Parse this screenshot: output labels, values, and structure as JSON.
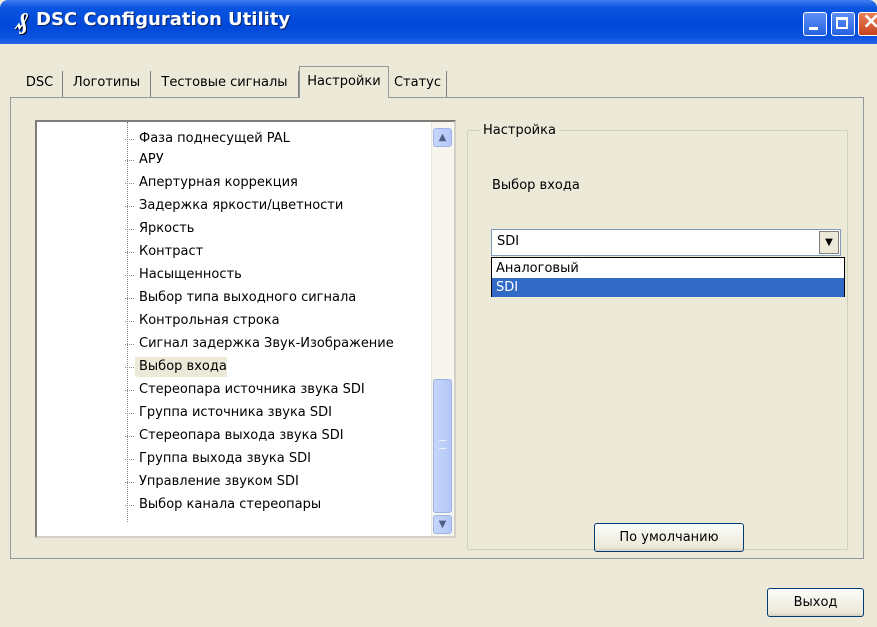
{
  "window": {
    "title": "DSC Configuration Utility",
    "icon": "app-logo-icon"
  },
  "tabs": [
    {
      "label": "DSC"
    },
    {
      "label": "Логотипы"
    },
    {
      "label": "Тестовые сигналы"
    },
    {
      "label": "Настройки",
      "selected": true
    },
    {
      "label": "Статус"
    }
  ],
  "tree": {
    "items": [
      "Фаза поднесущей PAL",
      "АРУ",
      "Апертурная коррекция",
      "Задержка яркости/цветности",
      "Яркость",
      "Контраст",
      "Насыщенность",
      "Выбор типа выходного сигнала",
      "Контрольная строка",
      "Сигнал задержка Звук-Изображение",
      "Выбор входа",
      "Стереопара источника звука SDI",
      "Группа источника звука SDI",
      "Стереопара выхода звука SDI",
      "Группа выхода звука SDI",
      "Управление звуком SDI",
      "Выбор канала стереопары"
    ],
    "selected": "Выбор входа"
  },
  "settings": {
    "group_label": "Настройка",
    "field_label": "Выбор входа",
    "combo_value": "SDI",
    "options": [
      "Аналоговый",
      "SDI"
    ],
    "selected_option": "SDI",
    "default_button": "По умолчанию"
  },
  "footer": {
    "exit_button": "Выход"
  },
  "colors": {
    "titlebar": "#0048d8",
    "selection": "#316ac5",
    "dialog": "#ece9d8"
  }
}
